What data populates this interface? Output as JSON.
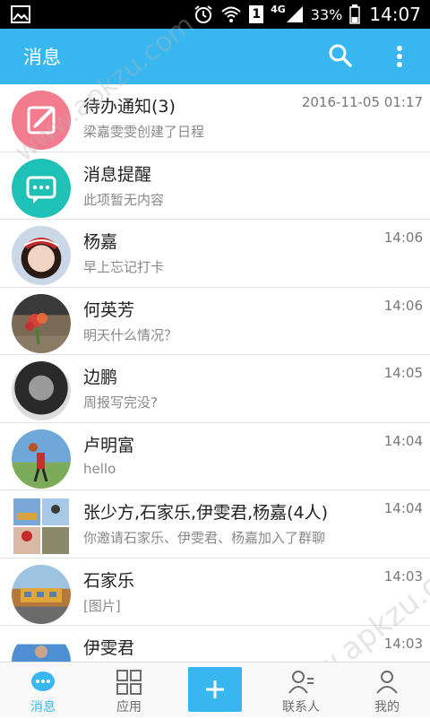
{
  "status_bar": {
    "battery": "33%",
    "network": "4G",
    "sim": "1",
    "time": "14:07"
  },
  "app_bar": {
    "title": "消息"
  },
  "conversations": [
    {
      "title": "待办通知(3)",
      "subtitle": "梁嘉雯雯创建了日程",
      "time": "2016-11-05 01:17",
      "avatar": "todo-icon",
      "avatar_color": "#f27b8e"
    },
    {
      "title": "消息提醒",
      "subtitle": "此项暂无内容",
      "time": "",
      "avatar": "chat-bubble-icon",
      "avatar_color": "#1fc1b6"
    },
    {
      "title": "杨嘉",
      "subtitle": "早上忘记打卡",
      "time": "14:06",
      "avatar": "photo-avatar"
    },
    {
      "title": "何英芳",
      "subtitle": "明天什么情况？",
      "time": "14:06",
      "avatar": "photo-avatar"
    },
    {
      "title": "边鹏",
      "subtitle": "周报写完没?",
      "time": "14:05",
      "avatar": "photo-avatar"
    },
    {
      "title": "卢明富",
      "subtitle": "hello",
      "time": "14:04",
      "avatar": "photo-avatar"
    },
    {
      "title": "张少方,石家乐,伊雯君,杨嘉(4人)",
      "subtitle": "你邀请石家乐、伊雯君、杨嘉加入了群聊",
      "time": "14:04",
      "avatar": "group-avatar"
    },
    {
      "title": "石家乐",
      "subtitle": "[图片]",
      "time": "14:03",
      "avatar": "photo-avatar"
    },
    {
      "title": "伊雯君",
      "subtitle": "",
      "time": "14:03",
      "avatar": "photo-avatar"
    }
  ],
  "bottom_nav": {
    "messages": "消息",
    "apps": "应用",
    "contacts": "联系人",
    "mine": "我的"
  },
  "watermark": {
    "top": "www.apkzu.com",
    "bottom": "www.apkzu.com"
  },
  "colors": {
    "accent": "#38b6ef",
    "statusbar": "#000000"
  }
}
